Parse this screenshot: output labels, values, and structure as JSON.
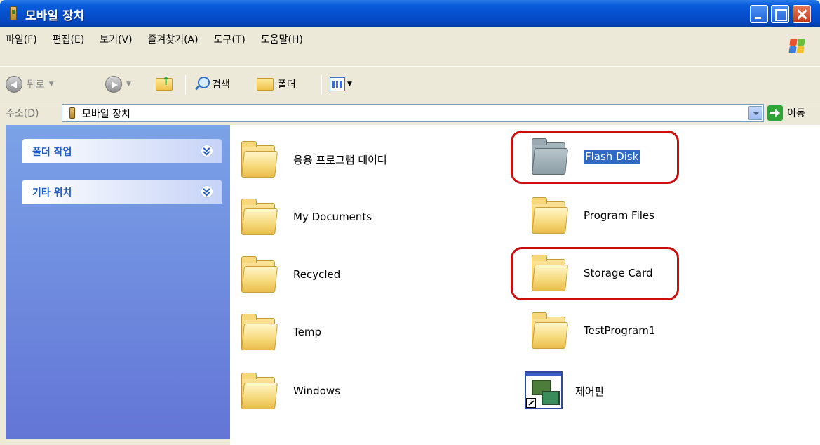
{
  "window": {
    "title": "모바일 장치"
  },
  "menu": {
    "items": [
      "파일(F)",
      "편집(E)",
      "보기(V)",
      "즐겨찾기(A)",
      "도구(T)",
      "도움말(H)"
    ]
  },
  "toolbar": {
    "back_label": "뒤로",
    "search_label": "검색",
    "folders_label": "폴더"
  },
  "address": {
    "label": "주소(D)",
    "value": "모바일 장치",
    "go_label": "이동"
  },
  "taskpane": {
    "panels": [
      "폴더 작업",
      "기타 위치"
    ]
  },
  "items": [
    {
      "name": "응용 프로그램 데이터",
      "icon": "folder-icon"
    },
    {
      "name": "Flash Disk",
      "icon": "folder-gray-icon",
      "selected": true,
      "highlighted": true
    },
    {
      "name": "My Documents",
      "icon": "folder-icon"
    },
    {
      "name": "Program Files",
      "icon": "folder-icon"
    },
    {
      "name": "Recycled",
      "icon": "folder-icon"
    },
    {
      "name": "Storage Card",
      "icon": "folder-icon",
      "highlighted": true
    },
    {
      "name": "Temp",
      "icon": "folder-icon"
    },
    {
      "name": "TestProgram1",
      "icon": "folder-icon"
    },
    {
      "name": "Windows",
      "icon": "folder-icon"
    },
    {
      "name": "제어판",
      "icon": "control-panel-shortcut-icon"
    }
  ],
  "colors": {
    "titlebar": "#0550D0",
    "highlight": "#D00D0D",
    "selection": "#316AC5"
  }
}
